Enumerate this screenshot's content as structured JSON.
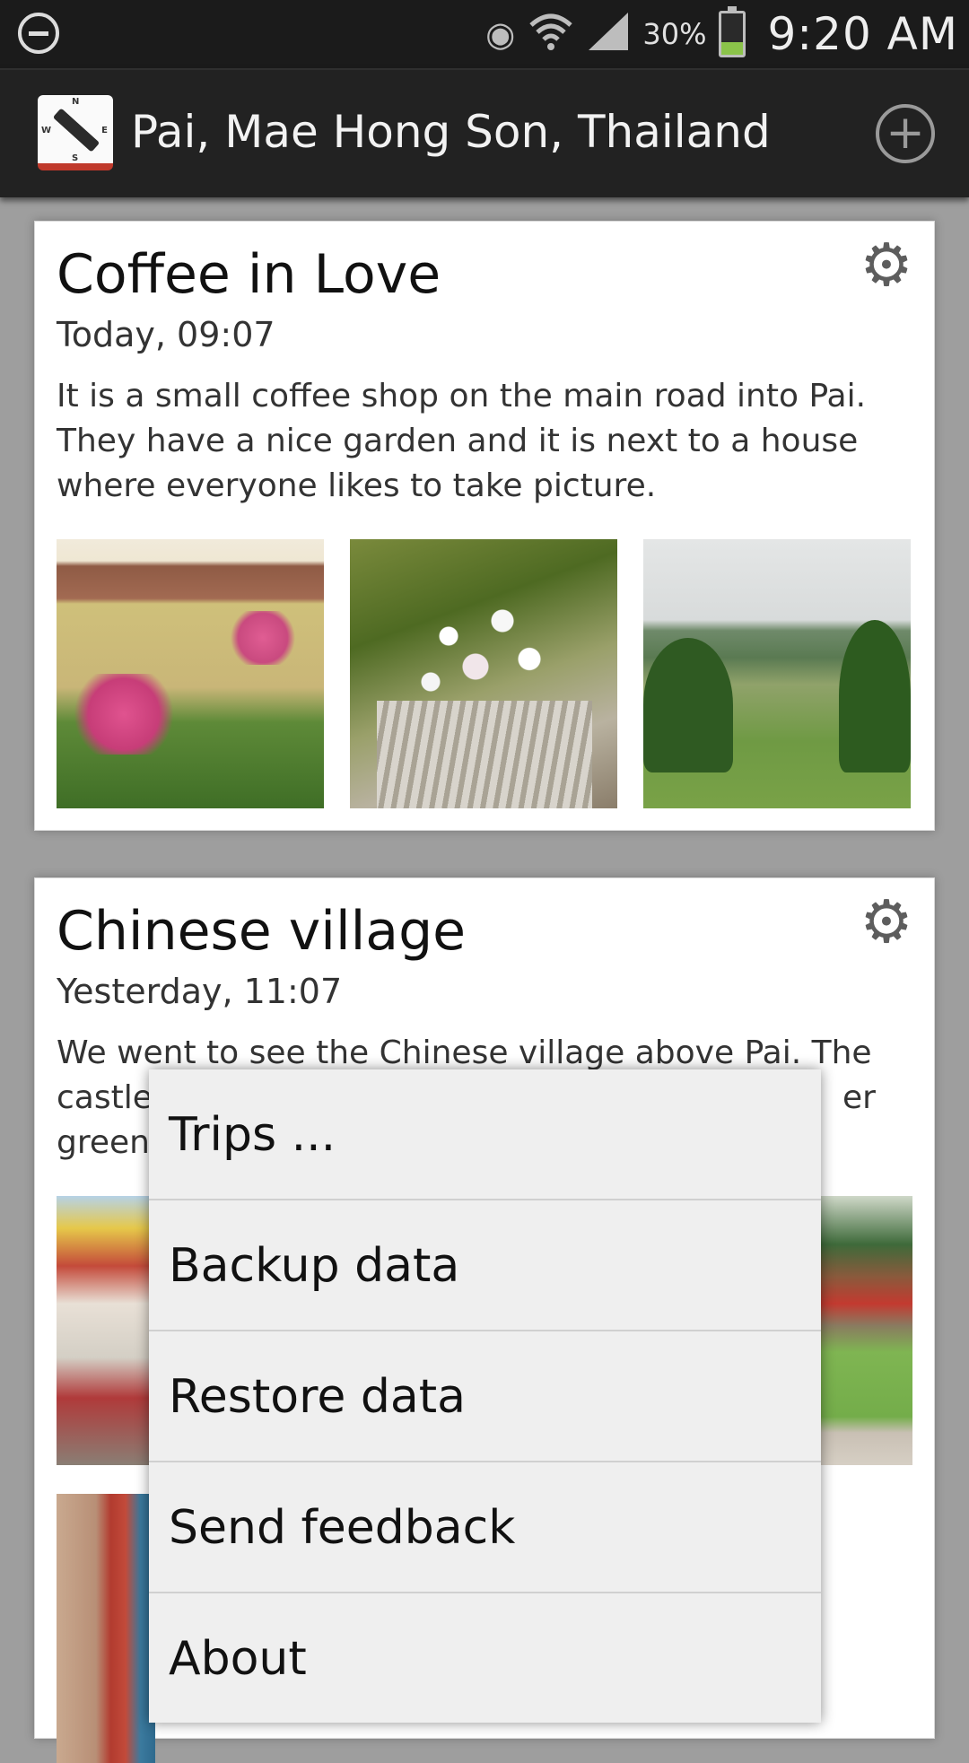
{
  "status_bar": {
    "battery_percent": "30%",
    "battery_level": 0.3,
    "time": "9:20 AM",
    "icons": [
      "do-not-disturb-icon",
      "eye-icon",
      "wifi-icon",
      "signal-icon",
      "battery-icon"
    ]
  },
  "action_bar": {
    "title": "Pai, Mae Hong Son, Thailand",
    "app_icon_letters": {
      "n": "N",
      "w": "W",
      "e": "E",
      "s": "S"
    },
    "add_icon": "plus-circle-icon"
  },
  "entries": [
    {
      "title": "Coffee in Love",
      "date": "Today, 09:07",
      "text": "It is a small coffee shop on the main road into Pai. They have a nice garden and it is next to a house where everyone likes to take picture.",
      "settings_icon": "gear-icon"
    },
    {
      "title": "Chinese village",
      "date": "Yesterday, 11:07",
      "text": "We went to see the Chinese village above Pai. The castle",
      "text_line2_prefix": "castle",
      "text_line2_suffix": "er",
      "text_line3_prefix": "green",
      "settings_icon": "gear-icon"
    }
  ],
  "overflow_menu": {
    "items": [
      "Trips ...",
      "Backup data",
      "Restore data",
      "Send feedback",
      "About"
    ]
  }
}
